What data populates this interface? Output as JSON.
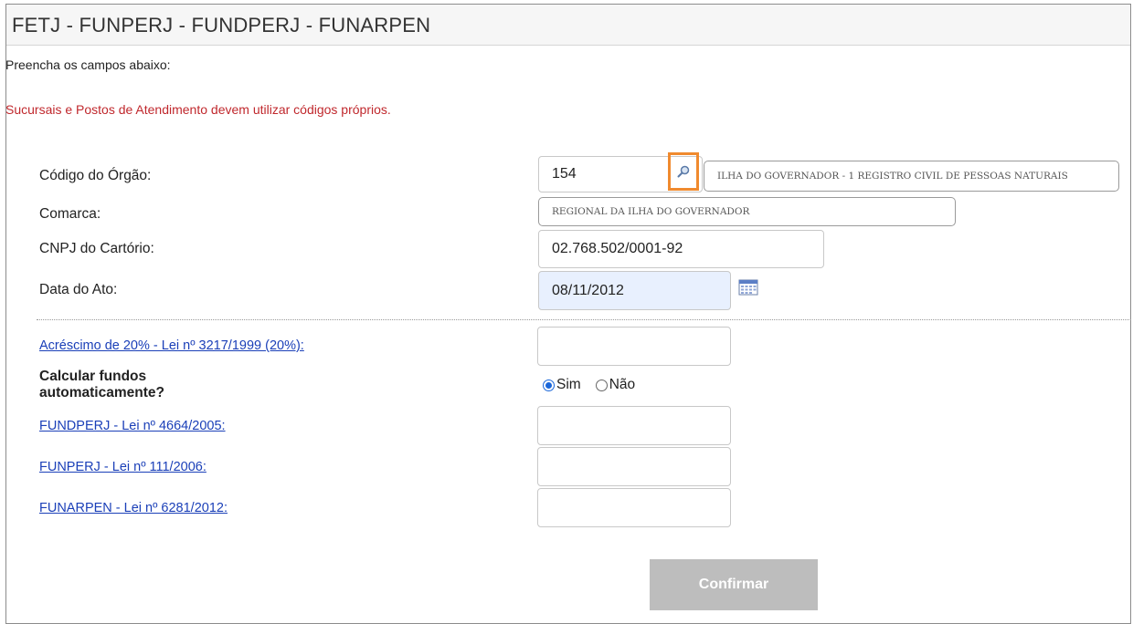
{
  "header": {
    "title": "FETJ - FUNPERJ - FUNDPERJ - FUNARPEN"
  },
  "instructions": "Preencha os campos abaixo:",
  "warning": "Sucursais e Postos de Atendimento devem utilizar códigos próprios.",
  "fields": {
    "codigo_orgao": {
      "label": "Código do Órgão:",
      "value": "154",
      "descricao": "ILHA DO GOVERNADOR - 1 REGISTRO CIVIL DE PESSOAS NATURAIS"
    },
    "comarca": {
      "label": "Comarca:",
      "value": "REGIONAL DA ILHA DO GOVERNADOR"
    },
    "cnpj": {
      "label": "CNPJ do Cartório:",
      "value": "02.768.502/0001-92"
    },
    "data_ato": {
      "label": "Data do Ato:",
      "value": "08/11/2012"
    },
    "acrescimo": {
      "label": "Acréscimo de 20% - Lei nº 3217/1999 (20%):",
      "value": ""
    },
    "calcular": {
      "label_line1": "Calcular fundos",
      "label_line2": "automaticamente?",
      "options": [
        "Sim",
        "Não"
      ],
      "selected": "Sim"
    },
    "fundperj": {
      "label": "FUNDPERJ - Lei nº 4664/2005:",
      "value": ""
    },
    "funperj": {
      "label": "FUNPERJ - Lei nº 111/2006:",
      "value": ""
    },
    "funarpen": {
      "label": "FUNARPEN - Lei nº 6281/2012:",
      "value": ""
    }
  },
  "confirm_label": "Confirmar",
  "icons": {
    "search": "magnifier-icon",
    "calendar": "calendar-icon"
  },
  "colors": {
    "warning": "#c0282d",
    "link": "#1a3fb8",
    "highlight": "#f08a2e",
    "button_disabled": "#bdbdbd"
  }
}
